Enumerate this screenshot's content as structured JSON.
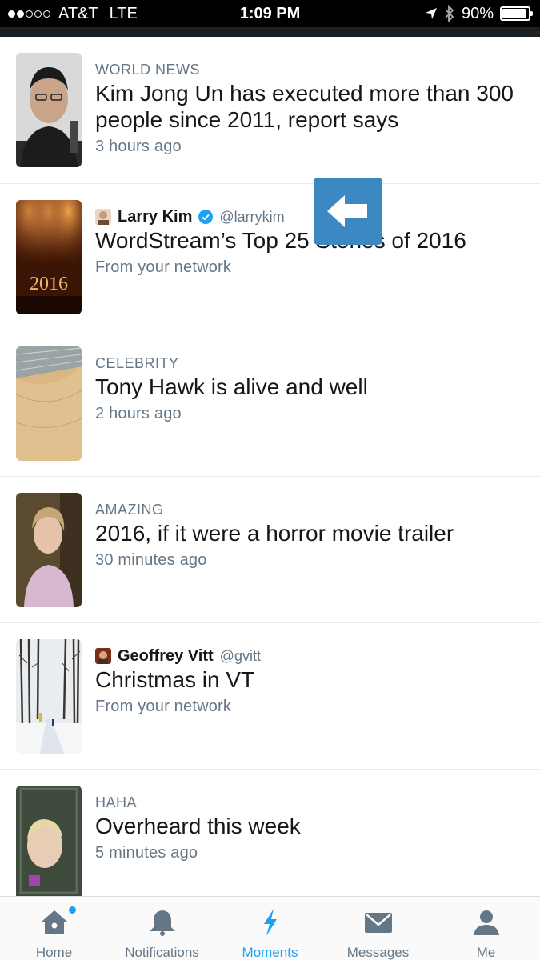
{
  "status_bar": {
    "carrier": "AT&T",
    "network": "LTE",
    "time": "1:09 PM",
    "battery": "90%",
    "battery_level": 0.9,
    "signal_bars_filled": 2,
    "signal_bars_total": 5
  },
  "moments": [
    {
      "category": "WORLD NEWS",
      "title_line1": "Kim Jong Un has executed more than 300",
      "title_line2": "people since 2011, report says",
      "meta": "3 hours ago"
    },
    {
      "author_name": "Larry Kim",
      "author_handle": "@larrykim",
      "title": "WordStream’s Top 25 Stories of 2016",
      "meta": "From your network",
      "thumb_text": "2016"
    },
    {
      "category": "CELEBRITY",
      "title": "Tony Hawk is alive and well",
      "meta": "2 hours ago"
    },
    {
      "category": "AMAZING",
      "title": "2016, if it were a horror movie trailer",
      "meta": "30 minutes ago"
    },
    {
      "author_name": "Geoffrey Vitt",
      "author_handle": "@gvitt",
      "title": "Christmas in VT",
      "meta": "From your network"
    },
    {
      "category": "HAHA",
      "title": "Overheard this week",
      "meta": "5 minutes ago"
    }
  ],
  "tabs": {
    "home": "Home",
    "notifications": "Notifications",
    "moments": "Moments",
    "messages": "Messages",
    "me": "Me"
  },
  "colors": {
    "accent": "#1da1f2",
    "overlay_button": "#3b88c3",
    "muted_text": "#657786"
  }
}
